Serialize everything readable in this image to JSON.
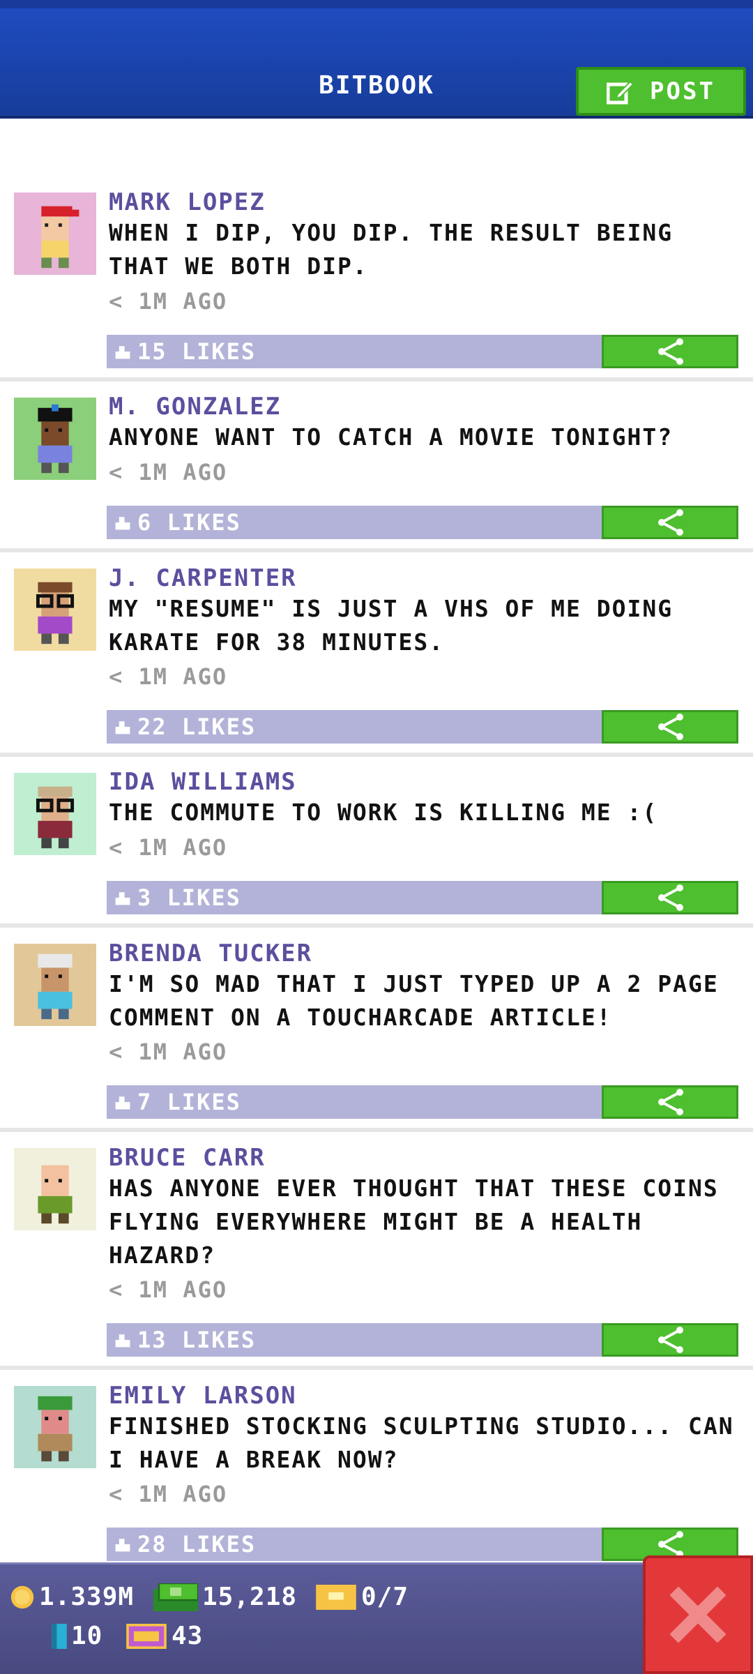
{
  "header": {
    "title": "BITBOOK",
    "post_label": "POST"
  },
  "posts": [
    {
      "author": "MARK LOPEZ",
      "message": "WHEN I DIP, YOU DIP. THE RESULT BEING THAT WE BOTH DIP.",
      "time": "< 1M AGO",
      "likes": "15 LIKES",
      "avatar_bg": "#e8b4d8"
    },
    {
      "author": "M. GONZALEZ",
      "message": "ANYONE WANT TO CATCH A MOVIE TONIGHT?",
      "time": "< 1M AGO",
      "likes": "6 LIKES",
      "avatar_bg": "#8ccf7a"
    },
    {
      "author": "J. CARPENTER",
      "message": "MY \"RESUME\" IS JUST A VHS OF ME DOING KARATE FOR 38 MINUTES.",
      "time": "< 1M AGO",
      "likes": "22 LIKES",
      "avatar_bg": "#f0dca0"
    },
    {
      "author": "IDA WILLIAMS",
      "message": "THE COMMUTE TO WORK IS KILLING ME :(",
      "time": "< 1M AGO",
      "likes": "3 LIKES",
      "avatar_bg": "#bfeed0"
    },
    {
      "author": "BRENDA TUCKER",
      "message": "I'M SO MAD THAT I JUST TYPED UP A 2 PAGE COMMENT ON A TOUCHARCADE ARTICLE!",
      "time": "< 1M AGO",
      "likes": "7 LIKES",
      "avatar_bg": "#e2c898"
    },
    {
      "author": "BRUCE CARR",
      "message": "HAS ANYONE EVER THOUGHT THAT THESE COINS FLYING EVERYWHERE MIGHT BE A HEALTH HAZARD?",
      "time": "< 1M AGO",
      "likes": "13 LIKES",
      "avatar_bg": "#f0f0dc"
    },
    {
      "author": "EMILY LARSON",
      "message": "FINISHED STOCKING SCULPTING STUDIO... CAN I HAVE A BREAK NOW?",
      "time": "< 1M AGO",
      "likes": "28 LIKES",
      "avatar_bg": "#b4dcd0"
    }
  ],
  "stats": {
    "coins": "1.339M",
    "bux": "15,218",
    "tickets": "0/7",
    "cards": "10",
    "gems": "43"
  },
  "colors": {
    "header": "#1e4cc0",
    "accent_green": "#4ebf2e",
    "author_purple": "#5b4f9e",
    "likes_bar": "#b3b3d9",
    "bottom_bar": "#5b5c9a",
    "close_red": "#e3383a"
  },
  "icons": {
    "post": "edit-icon",
    "like": "thumbs-up-icon",
    "share": "share-icon",
    "coin": "coin-icon",
    "bux": "bux-icon",
    "ticket": "ticket-icon",
    "card": "card-icon",
    "gem": "vip-icon",
    "close": "close-icon"
  }
}
